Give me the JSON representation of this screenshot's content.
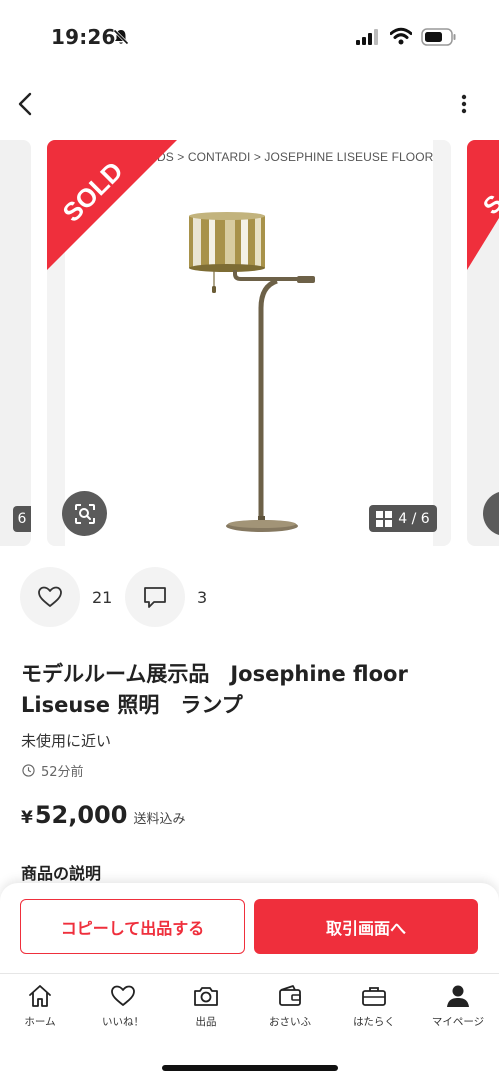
{
  "status_bar": {
    "time": "19:26"
  },
  "carousel": {
    "breadcrumb": "DS  >  CONTARDI  >  JOSEPHINE LISEUSE FLOOR",
    "sold_label": "SOLD",
    "counter": "4 / 6",
    "left_peek_counter": "6",
    "sold_color": "#ef2f3c"
  },
  "actions": {
    "like_count": "21",
    "comment_count": "3"
  },
  "item": {
    "title": "モデルルーム展示品　Josephine floor Liseuse 照明　ランプ",
    "condition": "未使用に近い",
    "posted_ago": "52分前",
    "price_symbol": "¥",
    "price": "52,000",
    "shipping": "送料込み",
    "description_heading": "商品の説明"
  },
  "bottom_actions": {
    "copy_label": "コピーして出品する",
    "trade_label": "取引画面へ",
    "accent": "#ef2f3c"
  },
  "tabs": [
    {
      "label": "ホーム",
      "icon": "home-icon"
    },
    {
      "label": "いいね！",
      "icon": "heart-icon"
    },
    {
      "label": "出品",
      "icon": "camera-icon"
    },
    {
      "label": "おさいふ",
      "icon": "wallet-icon"
    },
    {
      "label": "はたらく",
      "icon": "briefcase-icon"
    },
    {
      "label": "マイページ",
      "icon": "person-icon"
    }
  ]
}
